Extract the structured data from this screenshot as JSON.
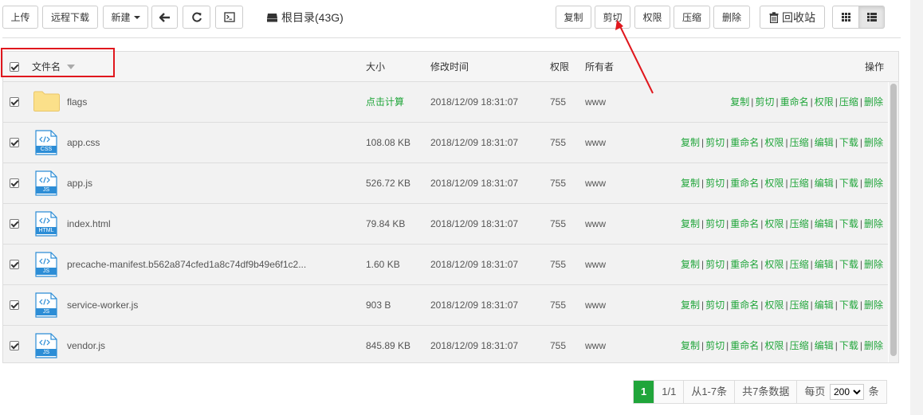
{
  "toolbar": {
    "upload": "上传",
    "remote_download": "远程下载",
    "new": "新建",
    "path_label": "根目录(43G)",
    "copy": "复制",
    "cut": "剪切",
    "permission": "权限",
    "compress": "压缩",
    "delete": "删除",
    "recycle_bin": "回收站"
  },
  "table": {
    "headers": {
      "name": "文件名",
      "size": "大小",
      "mtime": "修改时间",
      "perm": "权限",
      "owner": "所有者",
      "actions": "操作"
    },
    "rows": [
      {
        "name": "flags",
        "type": "folder",
        "badge": "",
        "size": "点击计算",
        "mtime": "2018/12/09 18:31:07",
        "perm": "755",
        "owner": "www",
        "ops": [
          "复制",
          "剪切",
          "重命名",
          "权限",
          "压缩",
          "删除"
        ]
      },
      {
        "name": "app.css",
        "type": "file",
        "badge": "CSS",
        "size": "108.08 KB",
        "mtime": "2018/12/09 18:31:07",
        "perm": "755",
        "owner": "www",
        "ops": [
          "复制",
          "剪切",
          "重命名",
          "权限",
          "压缩",
          "编辑",
          "下载",
          "删除"
        ]
      },
      {
        "name": "app.js",
        "type": "file",
        "badge": "JS",
        "size": "526.72 KB",
        "mtime": "2018/12/09 18:31:07",
        "perm": "755",
        "owner": "www",
        "ops": [
          "复制",
          "剪切",
          "重命名",
          "权限",
          "压缩",
          "编辑",
          "下载",
          "删除"
        ]
      },
      {
        "name": "index.html",
        "type": "file",
        "badge": "HTML",
        "size": "79.84 KB",
        "mtime": "2018/12/09 18:31:07",
        "perm": "755",
        "owner": "www",
        "ops": [
          "复制",
          "剪切",
          "重命名",
          "权限",
          "压缩",
          "编辑",
          "下载",
          "删除"
        ]
      },
      {
        "name": "precache-manifest.b562a874cfed1a8c74df9b49e6f1c2...",
        "type": "file",
        "badge": "JS",
        "size": "1.60 KB",
        "mtime": "2018/12/09 18:31:07",
        "perm": "755",
        "owner": "www",
        "ops": [
          "复制",
          "剪切",
          "重命名",
          "权限",
          "压缩",
          "编辑",
          "下载",
          "删除"
        ]
      },
      {
        "name": "service-worker.js",
        "type": "file",
        "badge": "JS",
        "size": "903 B",
        "mtime": "2018/12/09 18:31:07",
        "perm": "755",
        "owner": "www",
        "ops": [
          "复制",
          "剪切",
          "重命名",
          "权限",
          "压缩",
          "编辑",
          "下载",
          "删除"
        ]
      },
      {
        "name": "vendor.js",
        "type": "file",
        "badge": "JS",
        "size": "845.89 KB",
        "mtime": "2018/12/09 18:31:07",
        "perm": "755",
        "owner": "www",
        "ops": [
          "复制",
          "剪切",
          "重命名",
          "权限",
          "压缩",
          "编辑",
          "下载",
          "删除"
        ]
      }
    ]
  },
  "pager": {
    "current": "1",
    "pages": "1/1",
    "range": "从1-7条",
    "total": "共7条数据",
    "per_page_label": "每页",
    "per_page_value": "200",
    "unit": "条"
  },
  "colors": {
    "accent": "#20a53a",
    "highlight": "#e0171d"
  }
}
